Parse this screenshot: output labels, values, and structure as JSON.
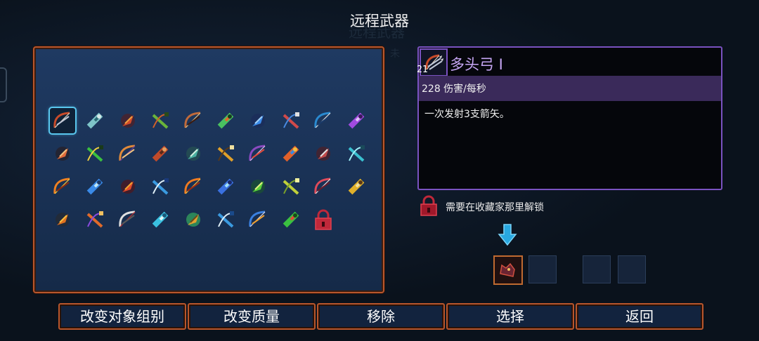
{
  "screen_title": "远程武器",
  "selected_item": {
    "name": "多头弓 I",
    "count": "21",
    "stat": "228 伤害/每秒",
    "description": "一次发射3支箭矢。",
    "unlock_text": "需要在收藏家那里解锁"
  },
  "grid_items": [
    {
      "icon": "multiple-nocks-bow-icon",
      "selected": true
    },
    {
      "icon": "crossbow-icon"
    },
    {
      "icon": "fire-bow-icon"
    },
    {
      "icon": "green-bow-icon"
    },
    {
      "icon": "heavy-crossbow-icon"
    },
    {
      "icon": "ice-bow-icon"
    },
    {
      "icon": "blue-bow-icon"
    },
    {
      "icon": "red-crossbow-icon"
    },
    {
      "icon": "sonic-bow-icon"
    },
    {
      "icon": "purple-bow-icon"
    },
    {
      "icon": "war-javelin-icon"
    },
    {
      "icon": "alchemic-carbine-icon"
    },
    {
      "icon": "boomerang-icon"
    },
    {
      "icon": "hunter-pick-icon"
    },
    {
      "icon": "pickaxe-icon"
    },
    {
      "icon": "throwing-knife-icon"
    },
    {
      "icon": "magic-missile-icon"
    },
    {
      "icon": "quick-bow-icon"
    },
    {
      "icon": "kunai-icon"
    },
    {
      "icon": "whip-icon"
    },
    {
      "icon": "fire-blast-icon"
    },
    {
      "icon": "ice-shards-icon"
    },
    {
      "icon": "fire-arrows-icon"
    },
    {
      "icon": "lightning-icon"
    },
    {
      "icon": "flame-orb-icon"
    },
    {
      "icon": "ice-crystal-icon"
    },
    {
      "icon": "poison-icon"
    },
    {
      "icon": "bamboo-icon"
    },
    {
      "icon": "cards-icon"
    },
    {
      "icon": "golden-bow-icon"
    },
    {
      "icon": "fire-pot-icon"
    },
    {
      "icon": "magic-bow-icon"
    },
    {
      "icon": "cleaver-icon"
    },
    {
      "icon": "ice-sickle-icon"
    },
    {
      "icon": "totem-icon"
    },
    {
      "icon": "shuriken-icon"
    },
    {
      "icon": "vortex-icon"
    },
    {
      "icon": "plant-icon"
    },
    {
      "icon": "padlock-icon"
    }
  ],
  "mini_slots": [
    {
      "state": "active",
      "icon": "wolf-head-icon"
    },
    {
      "state": "empty"
    },
    {
      "state": "empty"
    },
    {
      "state": "empty"
    }
  ],
  "buttons": {
    "change_group": "改变对象组别",
    "change_quality": "改变质量",
    "remove": "移除",
    "select": "选择",
    "back": "返回"
  },
  "background": {
    "faded_title": "远程武器",
    "faded_tag": "未"
  },
  "colors": {
    "accent_orange": "#b8562c",
    "accent_purple": "#7a52c0",
    "selection_cyan": "#59c6ee",
    "panel_blue": "#1a3256"
  }
}
